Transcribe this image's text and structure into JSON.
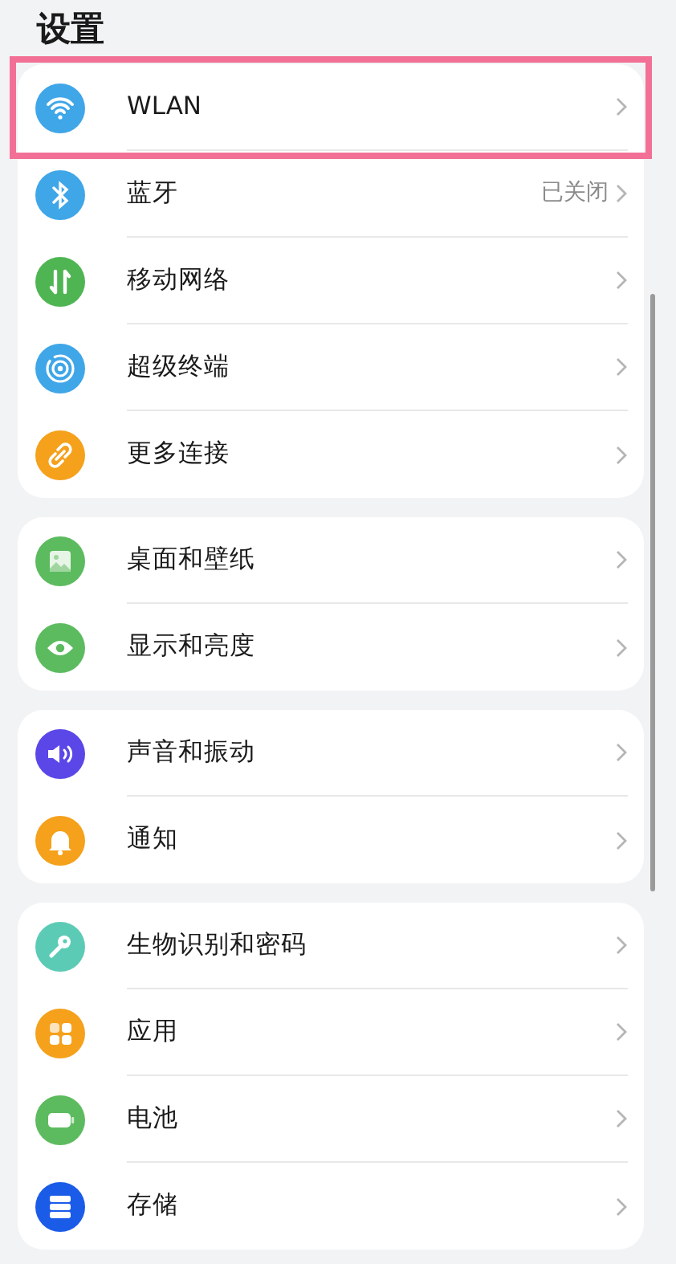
{
  "title": "设置",
  "groups": [
    {
      "items": [
        {
          "label": "WLAN",
          "color": "#3fa6e8",
          "highlighted": true
        },
        {
          "label": "蓝牙",
          "color": "#3fa6e8",
          "value": "已关闭",
          "highlighted": false
        },
        {
          "label": "移动网络",
          "color": "#4fb553",
          "highlighted": false
        },
        {
          "label": "超级终端",
          "color": "#3fa6e8",
          "highlighted": false
        },
        {
          "label": "更多连接",
          "color": "#f5a11c",
          "highlighted": false
        }
      ]
    },
    {
      "items": [
        {
          "label": "桌面和壁纸",
          "color": "#5cbb5f",
          "highlighted": false
        },
        {
          "label": "显示和亮度",
          "color": "#5cbb5f",
          "highlighted": false
        }
      ]
    },
    {
      "items": [
        {
          "label": "声音和振动",
          "color": "#5b47e8",
          "highlighted": false
        },
        {
          "label": "通知",
          "color": "#f5a11c",
          "highlighted": false
        }
      ]
    },
    {
      "items": [
        {
          "label": "生物识别和密码",
          "color": "#5ccbb5",
          "highlighted": false
        },
        {
          "label": "应用",
          "color": "#f5a11c",
          "highlighted": false
        },
        {
          "label": "电池",
          "color": "#5cbb5f",
          "highlighted": false
        },
        {
          "label": "存储",
          "color": "#1a5ce8",
          "highlighted": false
        }
      ]
    }
  ]
}
